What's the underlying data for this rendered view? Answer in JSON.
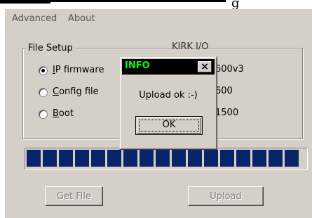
{
  "topstrip": {
    "glyph": "g"
  },
  "menu": {
    "advanced": "Advanced",
    "about": "About"
  },
  "group": {
    "title": "File Setup",
    "right_title": "KIRK I/O",
    "radios": [
      {
        "label": "IP firmware",
        "checked": true
      },
      {
        "label": "Config file",
        "checked": false
      },
      {
        "label": "Boot",
        "checked": false
      }
    ],
    "values": [
      "600v3",
      "600",
      "1500"
    ]
  },
  "progress": {
    "value": 1.0,
    "chunks": 17
  },
  "buttons": {
    "get_file": "Get File",
    "upload": "Upload"
  },
  "dialog": {
    "title": "INFO",
    "message": "Upload ok :-)",
    "ok": "OK",
    "close": "×"
  }
}
